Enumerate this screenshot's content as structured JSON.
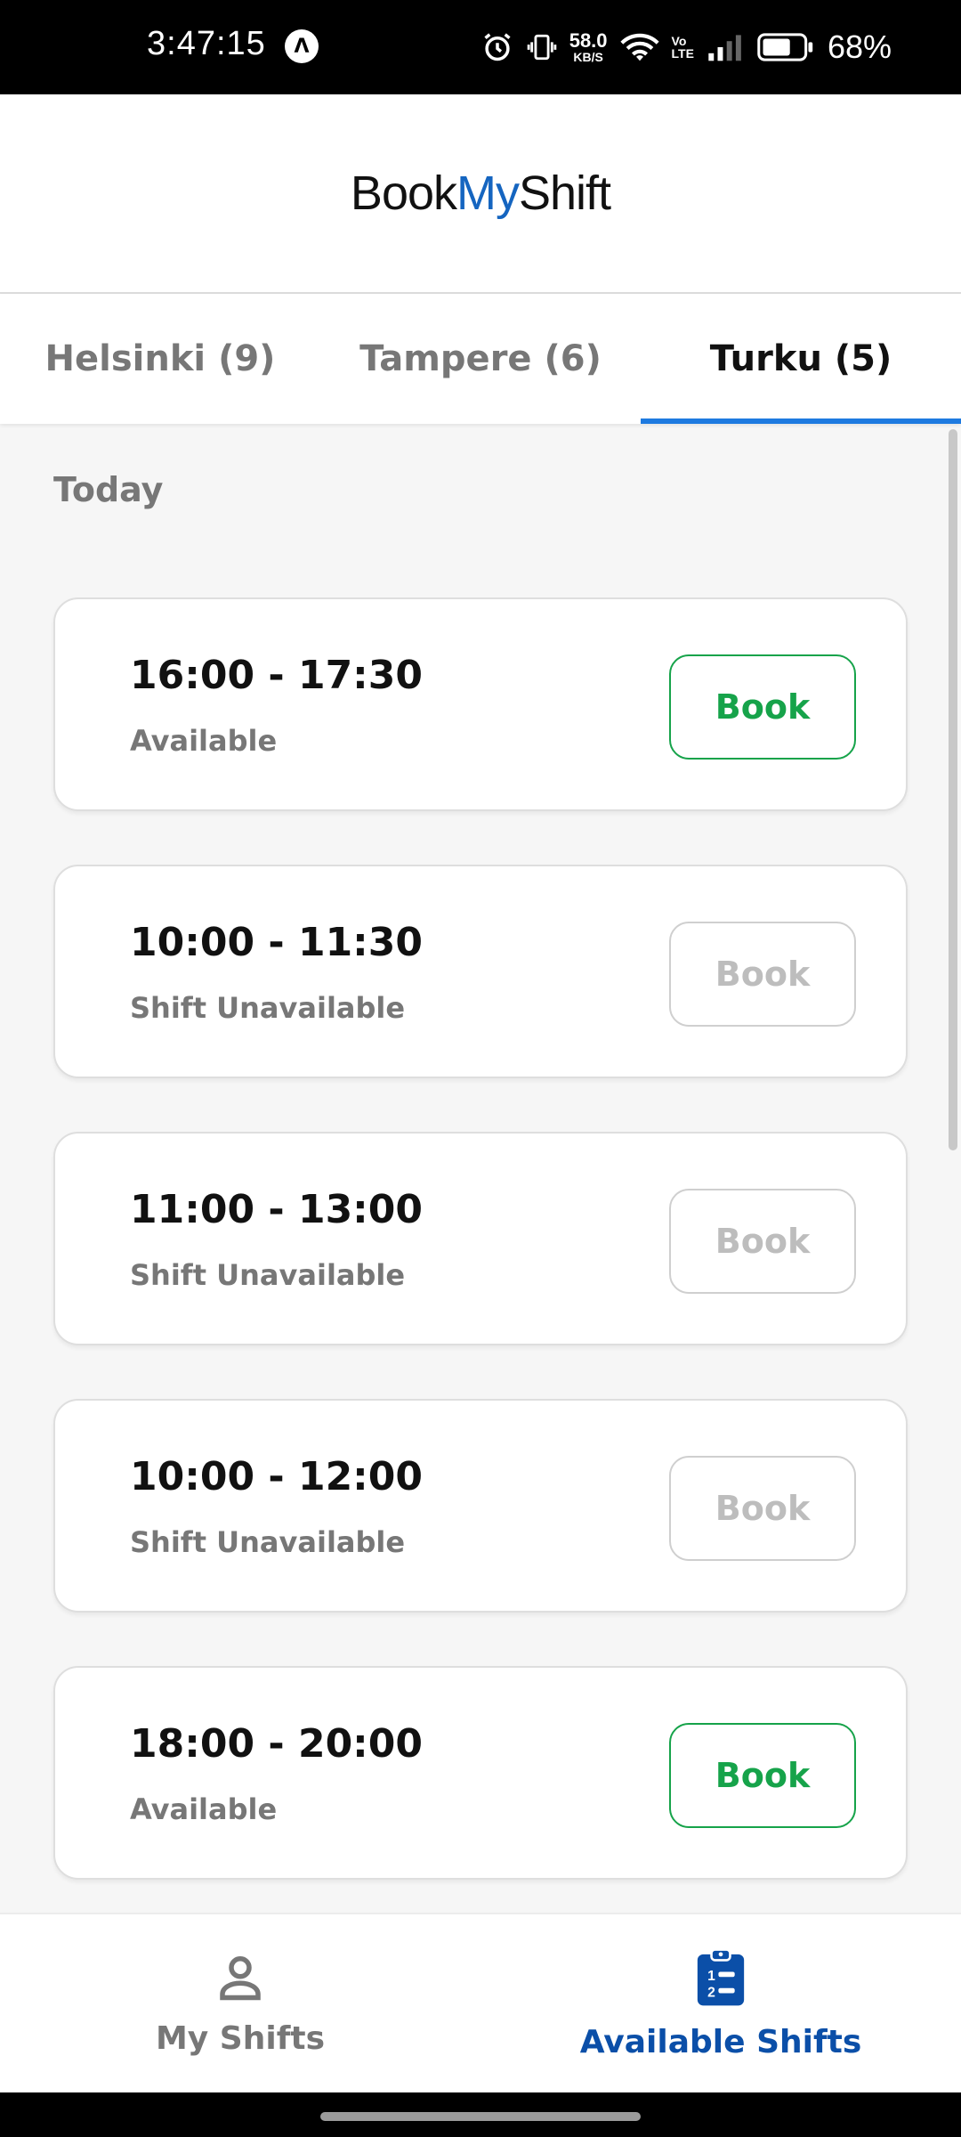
{
  "status_bar": {
    "time": "3:47:15",
    "app_icon": "Λ",
    "net_speed_value": "58.0",
    "net_speed_unit": "KB/S",
    "volte_top": "Vo",
    "volte_bottom": "LTE",
    "battery_percent": "68%",
    "icons": [
      "alarm-icon",
      "vibrate-icon",
      "wifi-icon",
      "signal-icon",
      "battery-icon"
    ]
  },
  "header": {
    "logo_part1": "Book",
    "logo_part2": "My",
    "logo_part3": "Shift",
    "accent_color": "#1565c0"
  },
  "tabs": [
    {
      "label": "Helsinki (9)",
      "active": false
    },
    {
      "label": "Tampere (6)",
      "active": false
    },
    {
      "label": "Turku (5)",
      "active": true
    }
  ],
  "section": {
    "heading": "Today"
  },
  "shifts": [
    {
      "time": "16:00 - 17:30",
      "status": "Available",
      "button": "Book",
      "enabled": true
    },
    {
      "time": "10:00 - 11:30",
      "status": "Shift Unavailable",
      "button": "Book",
      "enabled": false
    },
    {
      "time": "11:00 - 13:00",
      "status": "Shift Unavailable",
      "button": "Book",
      "enabled": false
    },
    {
      "time": "10:00 - 12:00",
      "status": "Shift Unavailable",
      "button": "Book",
      "enabled": false
    },
    {
      "time": "18:00 - 20:00",
      "status": "Available",
      "button": "Book",
      "enabled": true
    }
  ],
  "bottom_nav": {
    "my_shifts_label": "My Shifts",
    "available_shifts_label": "Available Shifts",
    "active": "available_shifts"
  },
  "colors": {
    "book_enabled": "#16a34a",
    "book_disabled": "#bdbdbd",
    "tab_indicator": "#1e7ae0",
    "nav_active": "#0b4fa8"
  }
}
